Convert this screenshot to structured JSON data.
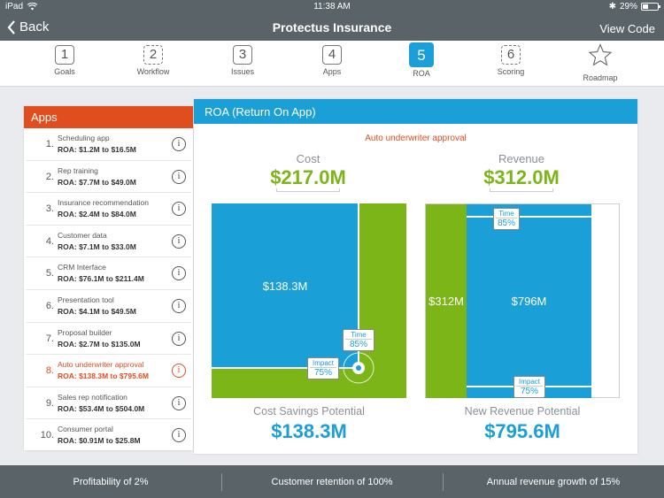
{
  "status": {
    "device": "iPad",
    "time": "11:38 AM",
    "battery": "29%",
    "battery_level": 0.29
  },
  "nav": {
    "back": "Back",
    "title": "Protectus Insurance",
    "view_code": "View Code"
  },
  "steps": [
    {
      "num": "1",
      "label": "Goals"
    },
    {
      "num": "2",
      "label": "Workflow"
    },
    {
      "num": "3",
      "label": "Issues"
    },
    {
      "num": "4",
      "label": "Apps"
    },
    {
      "num": "5",
      "label": "ROA"
    },
    {
      "num": "6",
      "label": "Scoring"
    },
    {
      "num": "",
      "label": "Roadmap"
    }
  ],
  "apps": {
    "title": "Apps",
    "items": [
      {
        "idx": "1.",
        "name": "Scheduling app",
        "roa": "ROA: $1.2M to $16.5M"
      },
      {
        "idx": "2.",
        "name": "Rep training",
        "roa": "ROA: $7.7M to $49.0M"
      },
      {
        "idx": "3.",
        "name": "Insurance recommendation",
        "roa": "ROA: $2.4M to $84.0M"
      },
      {
        "idx": "4.",
        "name": "Customer data",
        "roa": "ROA: $7.1M to $33.0M"
      },
      {
        "idx": "5.",
        "name": "CRM Interface",
        "roa": "ROA: $76.1M to $211.4M"
      },
      {
        "idx": "6.",
        "name": "Presentation tool",
        "roa": "ROA: $4.1M to $49.5M"
      },
      {
        "idx": "7.",
        "name": "Proposal builder",
        "roa": "ROA: $2.7M to $135.0M"
      },
      {
        "idx": "8.",
        "name": "Auto underwriter approval",
        "roa": "ROA: $138.3M to $795.6M"
      },
      {
        "idx": "9.",
        "name": "Sales rep notification",
        "roa": "ROA: $53.4M to $504.0M"
      },
      {
        "idx": "10.",
        "name": "Consumer portal",
        "roa": "ROA: $0.91M to $25.8M"
      }
    ]
  },
  "roa": {
    "title": "ROA (Return On App)",
    "subtitle": "Auto underwriter approval",
    "cost": {
      "label": "Cost",
      "value": "$217.0M",
      "inner_value": "$138.3M",
      "time_label": "Time",
      "time_value": "85%",
      "impact_label": "Impact",
      "impact_value": "75%",
      "bottom_label": "Cost Savings Potential",
      "bottom_value": "$138.3M"
    },
    "revenue": {
      "label": "Revenue",
      "value": "$312.0M",
      "left_value": "$312M",
      "inner_value": "$796M",
      "time_label": "Time",
      "time_value": "85%",
      "impact_label": "Impact",
      "impact_value": "75%",
      "bottom_label": "New Revenue Potential",
      "bottom_value": "$795.6M"
    }
  },
  "footer": {
    "items": [
      "Profitability of 2%",
      "Customer retention of 100%",
      "Annual revenue growth of 15%"
    ]
  }
}
